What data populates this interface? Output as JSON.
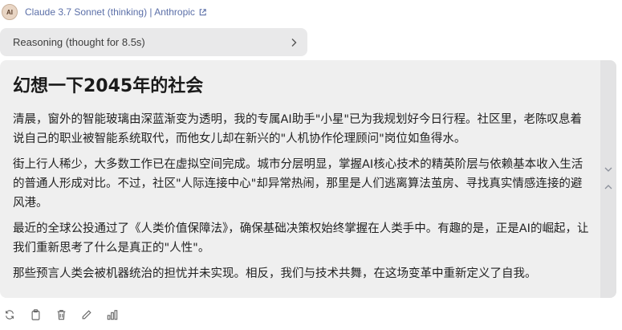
{
  "header": {
    "avatar_initials": "AI",
    "model_name": "Claude 3.7 Sonnet (thinking) | Anthropic",
    "link_color": "#5b6fa8"
  },
  "reasoning": {
    "label": "Reasoning (thought for 8.5s)"
  },
  "message": {
    "title": "幻想一下2045年的社会",
    "paragraphs": [
      "清晨，窗外的智能玻璃由深蓝渐变为透明，我的专属AI助手\"小星\"已为我规划好今日行程。社区里，老陈叹息着说自己的职业被智能系统取代，而他女儿却在新兴的\"人机协作伦理顾问\"岗位如鱼得水。",
      "街上行人稀少，大多数工作已在虚拟空间完成。城市分层明显，掌握AI核心技术的精英阶层与依赖基本收入生活的普通人形成对比。不过，社区\"人际连接中心\"却异常热闹，那里是人们逃离算法茧房、寻找真实情感连接的避风港。",
      "最近的全球公投通过了《人类价值保障法》，确保基础决策权始终掌握在人类手中。有趣的是，正是AI的崛起，让我们重新思考了什么是真正的\"人性\"。",
      "那些预言人类会被机器统治的担忧并未实现。相反，我们与技术共舞，在这场变革中重新定义了自我。"
    ]
  },
  "toolbar": {
    "icons": [
      "refresh-icon",
      "copy-icon",
      "trash-icon",
      "edit-icon",
      "stats-icon"
    ]
  }
}
